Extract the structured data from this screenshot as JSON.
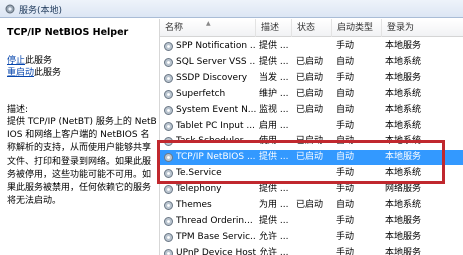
{
  "window": {
    "title": "服务(本地)"
  },
  "left": {
    "service_title": "TCP/IP NetBIOS Helper",
    "stop_link": "停止",
    "stop_rest": "此服务",
    "restart_link": "重启动",
    "restart_rest": "此服务",
    "desc_label": "描述:",
    "description": "提供 TCP/IP (NetBT) 服务上的 NetBIOS 和网络上客户端的 NetBIOS 名称解析的支持，从而使用户能够共享文件、打印和登录到网络。如果此服务被停用，这些功能可能不可用。如果此服务被禁用，任何依赖它的服务将无法启动。"
  },
  "columns": {
    "name": "名称",
    "desc": "描述",
    "status": "状态",
    "start": "启动类型",
    "logon": "登录为"
  },
  "services": [
    {
      "name": "SPP Notification ...",
      "desc": "提供 ...",
      "status": "",
      "start": "手动",
      "logon": "本地服务"
    },
    {
      "name": "SQL Server VSS ...",
      "desc": "提供 ...",
      "status": "已启动",
      "start": "自动",
      "logon": "本地系统"
    },
    {
      "name": "SSDP Discovery",
      "desc": "当发 ...",
      "status": "已启动",
      "start": "手动",
      "logon": "本地服务"
    },
    {
      "name": "Superfetch",
      "desc": "维护 ...",
      "status": "已启动",
      "start": "自动",
      "logon": "本地系统"
    },
    {
      "name": "System Event N...",
      "desc": "监视 ...",
      "status": "已启动",
      "start": "自动",
      "logon": "本地系统"
    },
    {
      "name": "Tablet PC Input ...",
      "desc": "启用 ...",
      "status": "",
      "start": "手动",
      "logon": "本地系统"
    },
    {
      "name": "Task Scheduler",
      "desc": "使用 ...",
      "status": "已启动",
      "start": "自动",
      "logon": "本地系统"
    },
    {
      "name": "TCP/IP NetBIOS ...",
      "desc": "提供 ...",
      "status": "已启动",
      "start": "自动",
      "logon": "本地服务"
    },
    {
      "name": "Te.Service",
      "desc": "",
      "status": "",
      "start": "手动",
      "logon": "本地系统"
    },
    {
      "name": "Telephony",
      "desc": "提供 ...",
      "status": "",
      "start": "手动",
      "logon": "网络服务"
    },
    {
      "name": "Themes",
      "desc": "为用 ...",
      "status": "已启动",
      "start": "自动",
      "logon": "本地系统"
    },
    {
      "name": "Thread Orderin...",
      "desc": "提供 ...",
      "status": "",
      "start": "手动",
      "logon": "本地服务"
    },
    {
      "name": "TPM Base Servic...",
      "desc": "允许 ...",
      "status": "",
      "start": "手动",
      "logon": "本地服务"
    },
    {
      "name": "UPnP Device Host",
      "desc": "允许 ...",
      "status": "",
      "start": "手动",
      "logon": "本地服务"
    }
  ],
  "selected_index": 7,
  "colors": {
    "selection": "#3399ff",
    "highlight_box": "#c0282e",
    "link": "#0645ad"
  },
  "icons": {
    "title": "gear-icon",
    "row": "service-gear-icon"
  }
}
